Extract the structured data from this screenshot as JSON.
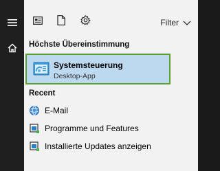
{
  "toolbar": {
    "filter_label": "Filter"
  },
  "best_match": {
    "heading": "Höchste Übereinstimmung",
    "title": "Systemsteuerung",
    "subtitle": "Desktop-App",
    "icon": "control-panel-icon"
  },
  "recent": {
    "heading": "Recent",
    "items": [
      {
        "label": "E-Mail",
        "icon": "email-icon"
      },
      {
        "label": "Programme und Features",
        "icon": "programs-icon"
      },
      {
        "label": "Installierte Updates anzeigen",
        "icon": "updates-icon"
      }
    ]
  },
  "colors": {
    "rail_bg": "#1f1f1f",
    "panel_bg": "#f2f2f2",
    "highlight_bg": "#bcd9f0",
    "highlight_border": "#5aa02c"
  }
}
